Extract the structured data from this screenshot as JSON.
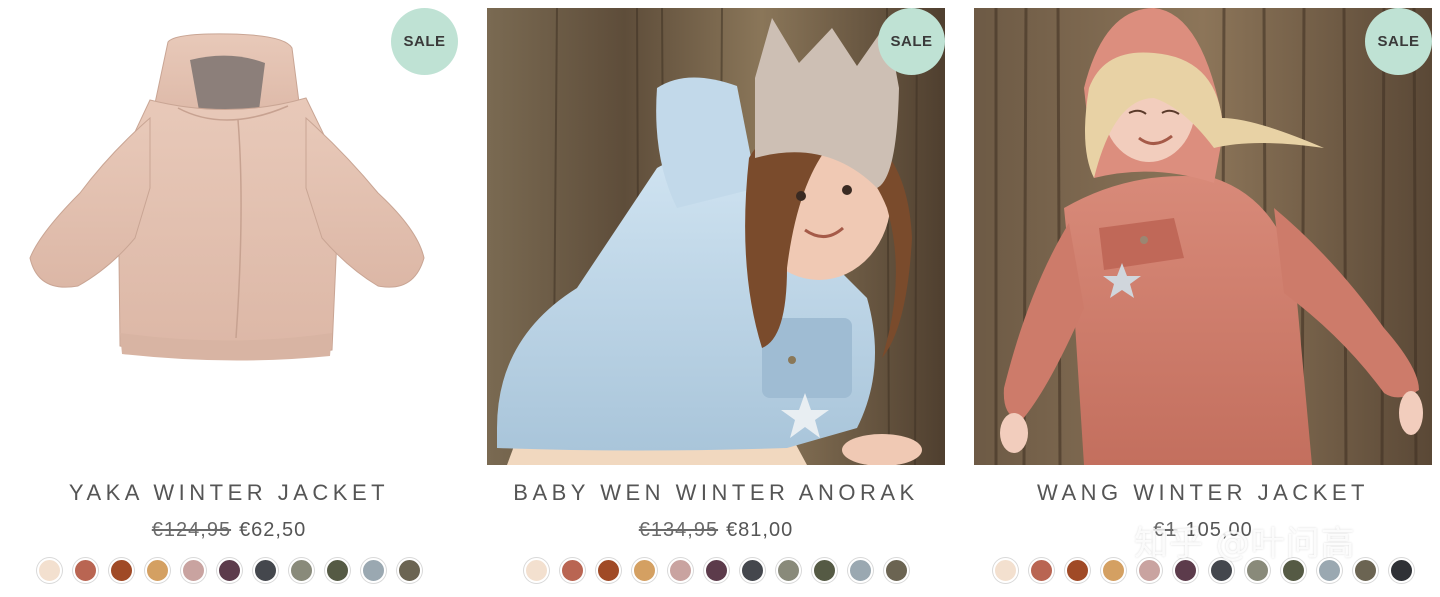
{
  "products": [
    {
      "name": "YAKA WINTER JACKET",
      "old_price": "€124,95",
      "new_price": "€62,50",
      "badge": "SALE",
      "swatches": [
        "#f3e0cf",
        "#b96552",
        "#a04a26",
        "#d4a062",
        "#c9a3a0",
        "#5c3b4b",
        "#44474d",
        "#898a7a",
        "#555a44",
        "#9aa8b1",
        "#6b6452"
      ]
    },
    {
      "name": "BABY WEN WINTER ANORAK",
      "old_price": "€134,95",
      "new_price": "€81,00",
      "badge": "SALE",
      "swatches": [
        "#f3e0cf",
        "#b96552",
        "#a04a26",
        "#d4a062",
        "#c9a3a0",
        "#5c3b4b",
        "#44474d",
        "#898a7a",
        "#555a44",
        "#9aa8b1",
        "#6b6452"
      ]
    },
    {
      "name": "WANG WINTER JACKET",
      "old_price": "€1",
      "new_price": "105,00",
      "badge": "SALE",
      "swatches": [
        "#f3e0cf",
        "#b96552",
        "#a04a26",
        "#d4a062",
        "#c9a3a0",
        "#5c3b4b",
        "#44474d",
        "#898a7a",
        "#555a44",
        "#9aa8b1",
        "#6b6452",
        "#2f3136"
      ]
    }
  ],
  "watermark": "知乎 @叶问高",
  "colors": {
    "badge_bg": "#bfe2d4",
    "text": "#555555"
  },
  "icons": {
    "product_1_image": "pink-jacket-product-photo",
    "product_2_image": "child-blue-anorak-photo",
    "product_3_image": "child-pink-jacket-photo",
    "swatch": "color-swatch"
  }
}
